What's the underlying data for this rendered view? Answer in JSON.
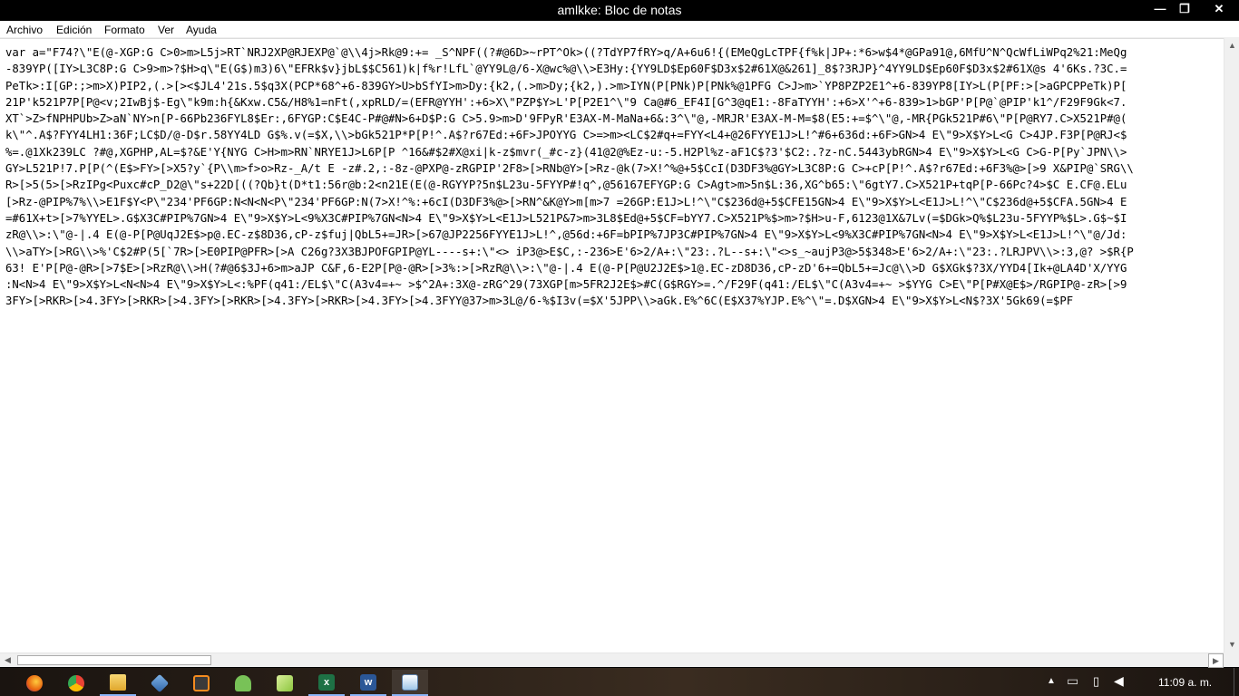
{
  "window": {
    "title": "amlkke: Bloc de notas",
    "minimize": "—",
    "maximize": "❐",
    "close": "✕"
  },
  "menu": [
    "Archivo",
    "Edición",
    "Formato",
    "Ver",
    "Ayuda"
  ],
  "editor": {
    "lines": [
      "var a=\"F74?\\\"E(@-XGP:G C>0>m>L5j>RT`NRJ2XP@RJEXP@`@\\\\4j>Rk@9:+= _S^NPF((?#@6D>~rPT^Ok>((?TdYP7fRY>q/A+6u6!{(EMeQgLcTPF{f%k|JP+:*6>w$4*@GPa91@,6MfU^N^QcWfLiWPq2%21:MeQg",
      "-839YP([IY>L3C8P:G C>9>m>?$H>q\\\"E(G$)m3)6\\\"EFRk$v}jbL$$C561)k|f%r!LfL`@YY9L@/6-X@wc%@\\\\>E3Hy:{YY9LD$Ep60F$D3x$2#61X@&261]_8$?3RJP}^4YY9LD$Ep60F$D3x$2#61X@s 4'6Ks.?3C.=",
      "PeTk>:I[GP:;>m>X)PIP2,(.>[><$JL4'21s.5$q3X(PCP*68^+6-839GY>U>bSfYI>m>Dy:{k2,(.>m>Dy;{k2,).>m>IYN(P[PNk)P[PNk%@1PFG C>J>m>`YP8PZP2E1^+6-839YP8[IY>L(P[PF:>[>aGPCPPeTk)P[",
      "21P'k521P7P[P@<v;2IwBj$-Eg\\\"k9m:h{&Kxw.C5&/H8%1=nFt(,xpRLD/=(EFR@YYH':+6>X\\\"PZP$Y>L'P[P2E1^\\\"9 Ca@#6_EF4I[G^3@qE1:-8FaTYYH':+6>X'^+6-839>1>bGP'P[P@`@PIP'k1^/F29F9Gk<7.",
      "XT`>Z>fNPHPUb>Z>aN`NY>n[P-66Pb236FYL8$Er:,6FYGP:C$E4C-P#@#N>6+D$P:G C>5.9>m>D'9FPyR'E3AX-M-MaNa+6&:3^\\\"@,-MRJR'E3AX-M-M=$8(E5:+=$^\\\"@,-MR{PGk521P#6\\\"P[P@RY7.C>X521P#@(",
      "k\\\"^.A$?FYY4LH1:36F;LC$D/@-D$r.58YY4LD G$%.v(=$X,\\\\>bGk521P*P[P!^.A$?r67Ed:+6F>JPOYYG C>=>m><LC$2#q+=FYY<L4+@26FYYE1J>L!^#6+636d:+6F>GN>4 E\\\"9>X$Y>L<G C>4JP.F3P[P@RJ<$",
      "%=.@1Xk239LC ?#@,XGPHP,AL=$?&E'Y{NYG C>H>m>RN`NRYE1J>L6P[P ^16&#$2#X@xi|k-z$mvr(_#c-z}(41@2@%Ez-u:-5.H2Pl%z-aF1C$?3'$C2:.?z-nC.5443ybRGN>4 E\\\"9>X$Y>L<G C>G-P[Py`JPN\\\\>",
      "GY>L521P!7.P[P(^(E$>FY>[>X5?y`{P\\\\m>f>o>Rz-_A/t E -z#.2,:-8z-@PXP@-zRGPIP'2F8>[>RNb@Y>[>Rz-@k(7>X!^%@+5$CcI(D3DF3%@GY>L3C8P:G C>+cP[P!^.A$?r67Ed:+6F3%@>[>9 X&PIP@`SRG\\\\",
      "R>[>5(5>[>RzIPg<Puxc#cP_D2@\\\"s+22D[((?Qb}t(D*t1:56r@b:2<n21E(E(@-RGYYP?5n$L23u-5FYYP#!q^,@56167EFYGP:G C>Agt>m>5n$L:36,XG^b65:\\\"6gtY7.C>X521P+tqP[P-66Pc?4>$C E.CF@.ELu",
      "[>Rz-@PIP%7%\\\\>E1F$Y<P\\\"234'PF6GP:N<N<N<P\\\"234'PF6GP:N(7>X!^%:+6cI(D3DF3%@>[>RN^&K@Y>m[m>7 =26GP:E1J>L!^\\\"C$236d@+5$CFE15GN>4 E\\\"9>X$Y>L<E1J>L!^\\\"C$236d@+5$CFA.5GN>4 E",
      "=#61X+t>[>7%YYEL>.G$X3C#PIP%7GN>4 E\\\"9>X$Y>L<9%X3C#PIP%7GN<N>4 E\\\"9>X$Y>L<E1J>L521P&7>m>3L8$Ed@+5$CF=bYY7.C>X521P%$>m>?$H>u-F,6123@1X&7Lv(=$DGk>Q%$L23u-5FYYP%$L>.G$~$I",
      "zR@\\\\>:\\\"@-|.4 E(@-P[P@UqJ2E$>p@.EC-z$8D36,cP-z$fuj|QbL5+=JR>[>67@JP2256FYYE1J>L!^,@56d:+6F=bPIP%7JP3C#PIP%7GN>4 E\\\"9>X$Y>L<9%X3C#PIP%7GN<N>4 E\\\"9>X$Y>L<E1J>L!^\\\"@/Jd:",
      "\\\\>aTY>[>RG\\\\>%'C$2#P(5[`7R>[>E0PIP@PFR>[>A C26g?3X3BJPOFGPIP@YL----s+:\\\"<> iP3@>E$C,:-236>E'6>2/A+:\\\"23:.?L--s+:\\\"<>s_~aujP3@>5$348>E'6>2/A+:\\\"23:.?LRJPV\\\\>:3,@? >$R{P",
      "63! E'P[P@-@R>[>7$E>[>RzR@\\\\>H(?#@6$3J+6>m>aJP C&F,6-E2P[P@-@R>[>3%:>[>RzR@\\\\>:\\\"@-|.4 E(@-P[P@U2J2E$>1@.EC-zD8D36,cP-zD'6+=QbL5+=Jc@\\\\>D G$XGk$?3X/YYD4[Ik+@LA4D'X/YYG",
      ":N<N>4 E\\\"9>X$Y>L<N<N>4 E\\\"9>X$Y>L<:%PF(q41:/EL$\\\"C(A3v4=+~ >$^2A+:3X@-zRG^29(73XGP[m>5FR2J2E$>#C(G$RGY>=.^/F29F(q41:/EL$\\\"C(A3v4=+~ >$YYG C>E\\\"P[P#X@E$>/RGPIP@-zR>[>9",
      "3FY>[>RKR>[>4.3FY>[>RKR>[>4.3FY>[>RKR>[>4.3FY>[>RKR>[>4.3FY>[>4.3FYY@37>m>3L@/6-%$I3v(=$X'5JPP\\\\>aGk.E%^6C(E$X37%YJP.E%^\\\"=.D$XGN>4 E\\\"9>X$Y>L<N$?3X'5Gk69(=$PF"
    ]
  },
  "taskbar": {
    "apps": [
      {
        "name": "firefox-icon",
        "color": "#e8620f"
      },
      {
        "name": "chrome-icon",
        "color": "#34a853"
      },
      {
        "name": "file-explorer-icon",
        "color": "#f2c14e"
      },
      {
        "name": "virtualbox-icon",
        "color": "#4a86c8"
      },
      {
        "name": "sublime-text-icon",
        "color": "#f48b1f"
      },
      {
        "name": "android-studio-icon",
        "color": "#78c257"
      },
      {
        "name": "notepad-plus-icon",
        "color": "#8dc63f"
      },
      {
        "name": "excel-icon",
        "color": "#1e7145"
      },
      {
        "name": "word-icon",
        "color": "#2b5797"
      },
      {
        "name": "notepad-icon",
        "color": "#9fc6e8"
      }
    ],
    "clock": "11:09 a. m."
  }
}
